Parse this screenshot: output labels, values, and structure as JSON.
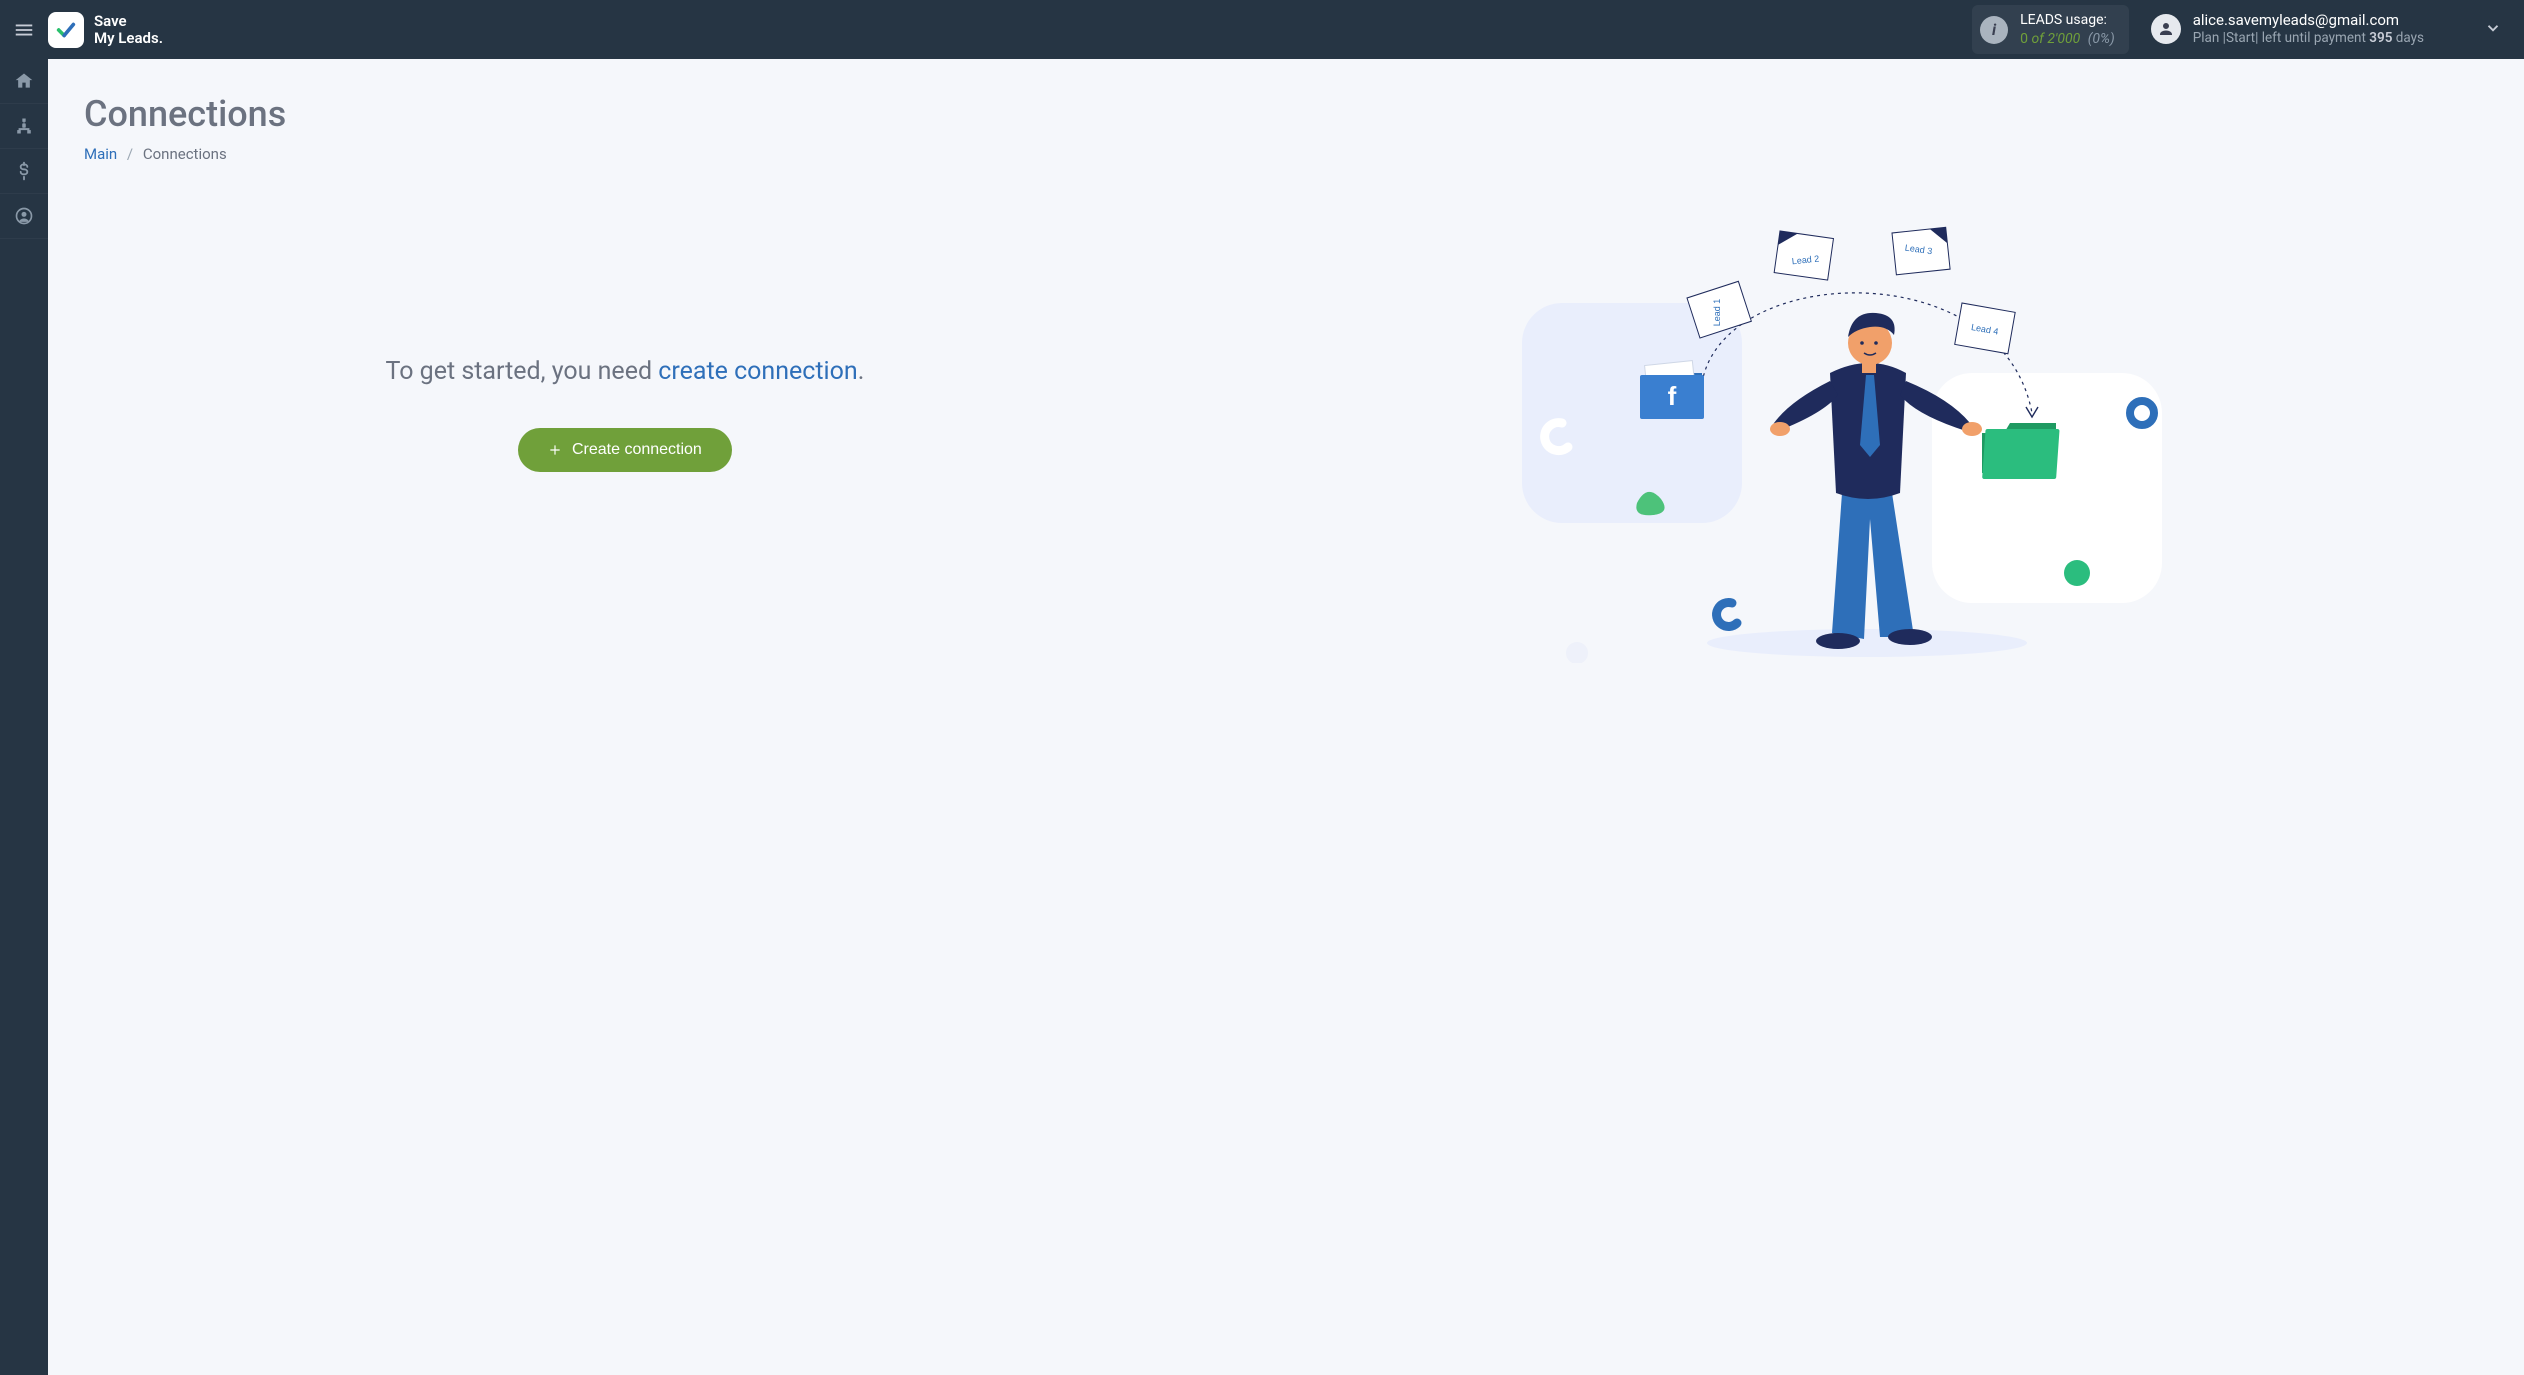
{
  "header": {
    "logo_line1": "Save",
    "logo_line2": "My Leads.",
    "leads": {
      "label": "LEADS usage:",
      "used": "0",
      "of_word": "of",
      "total": "2'000",
      "pct": "(0%)"
    },
    "account": {
      "email": "alice.savemyleads@gmail.com",
      "plan_pre": "Plan |",
      "plan_name": "Start",
      "plan_mid": "| left until payment",
      "plan_days": "395",
      "plan_days_word": "days"
    }
  },
  "page": {
    "title": "Connections",
    "breadcrumb": {
      "main": "Main",
      "current": "Connections"
    },
    "get_started_pre": "To get started, you need ",
    "get_started_link": "create connection",
    "get_started_post": ".",
    "create_connection_label": "Create connection"
  },
  "illustration": {
    "lead1": "Lead 1",
    "lead2": "Lead 2",
    "lead3": "Lead 3",
    "lead4": "Lead 4",
    "fb_letter": "f"
  }
}
